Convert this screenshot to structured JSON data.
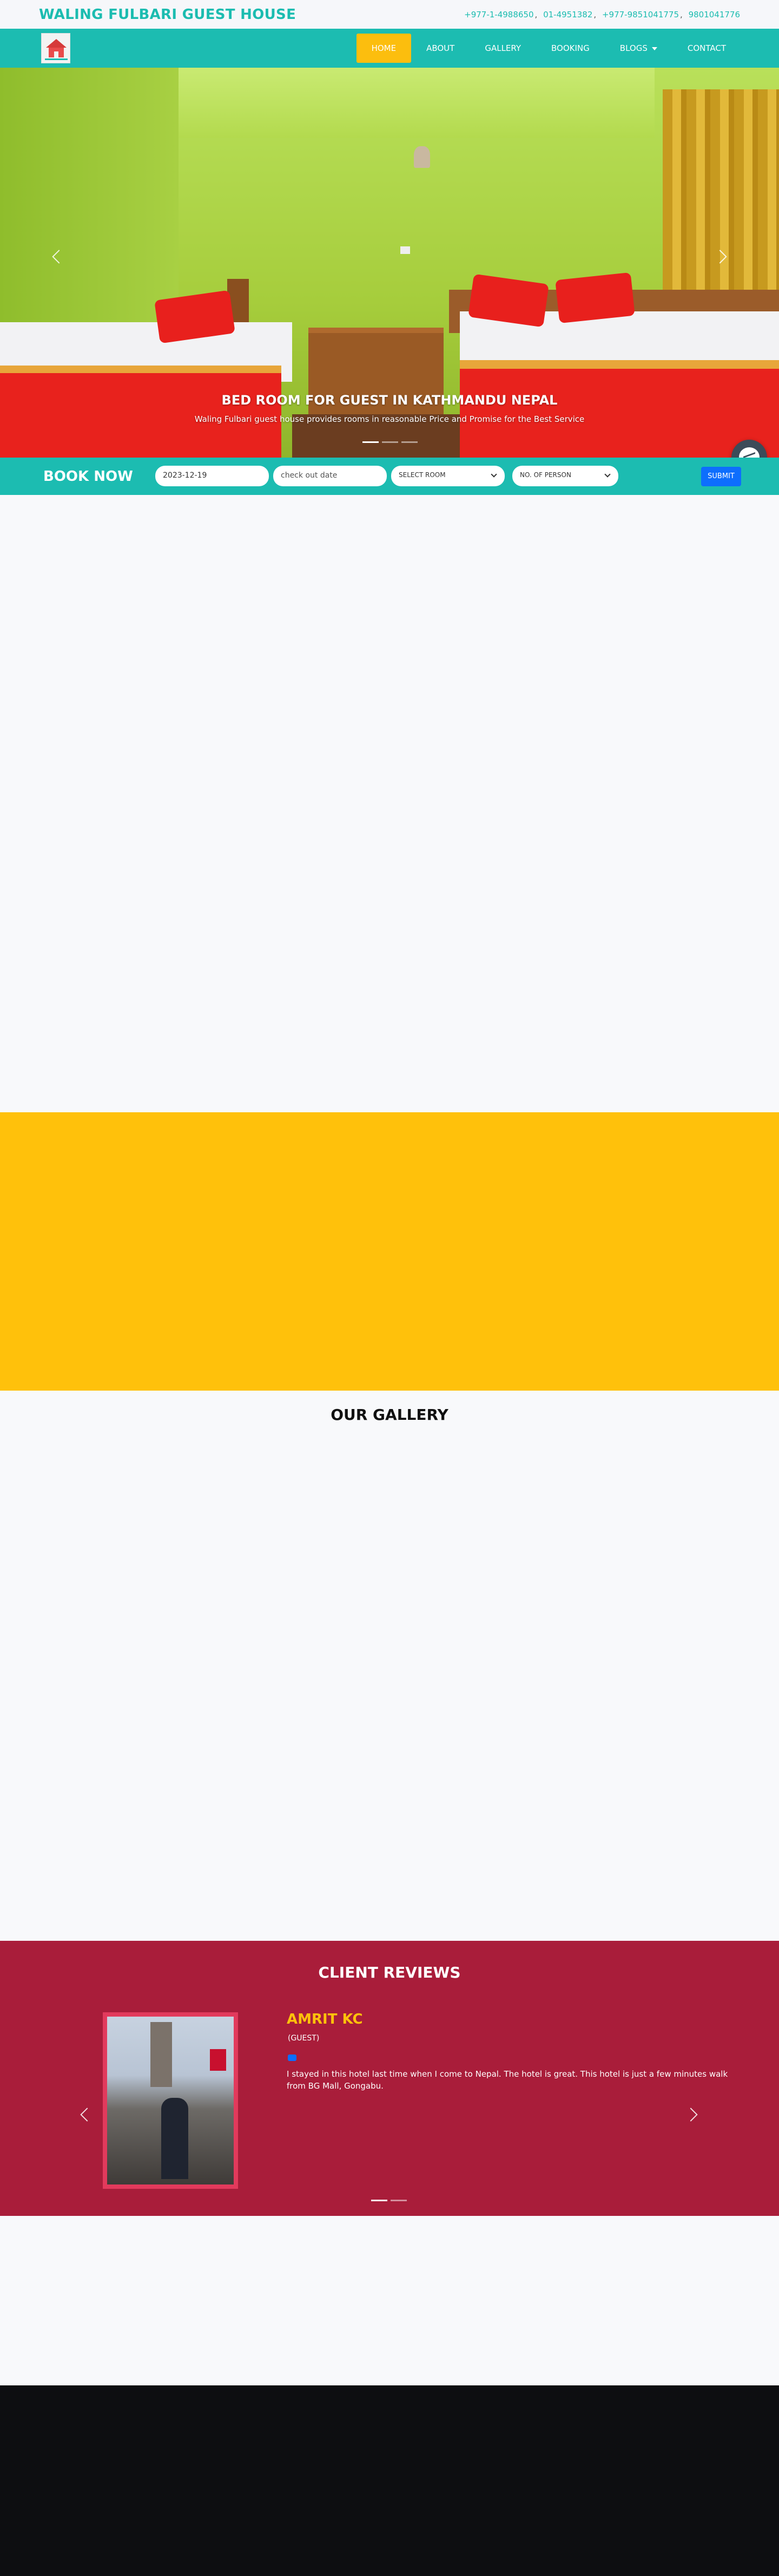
{
  "header": {
    "brand": "WALING FULBARI GUEST HOUSE",
    "phones": [
      "+977-1-4988650",
      "01-4951382",
      "+977-9851041775",
      "9801041776"
    ]
  },
  "nav": {
    "items": [
      {
        "label": "HOME",
        "active": true
      },
      {
        "label": "ABOUT"
      },
      {
        "label": "GALLERY"
      },
      {
        "label": "BOOKING"
      },
      {
        "label": "BLOGS",
        "dropdown": true
      },
      {
        "label": "CONTACT"
      }
    ]
  },
  "hero": {
    "title": "BED ROOM FOR GUEST IN KATHMANDU NEPAL",
    "subtitle": "Waling Fulbari guest house provides rooms in reasonable Price and Promise for the Best Service",
    "slides": 3,
    "active_slide": 1
  },
  "booking": {
    "title": "BOOK NOW",
    "checkin_value": "2023-12-19",
    "checkout_placeholder": "check out date",
    "room_select": "SELECT ROOM",
    "person_select": "NO. OF PERSON",
    "submit_label": "SUBMIT"
  },
  "gallery": {
    "title": "OUR GALLERY"
  },
  "reviews": {
    "title": "CLIENT REVIEWS",
    "name": "AMRIT KC",
    "role": "(GUEST)",
    "text": "I stayed in this hotel last time when I come to Nepal. The hotel is great. This hotel is just a few minutes walk from BG Mall, Gongabu.",
    "slides": 2,
    "active_slide": 1
  },
  "colors": {
    "teal": "#1cbcb1",
    "yellow": "#ffc10b",
    "crimson": "#a91d3a",
    "footer": "#0d0e11"
  }
}
